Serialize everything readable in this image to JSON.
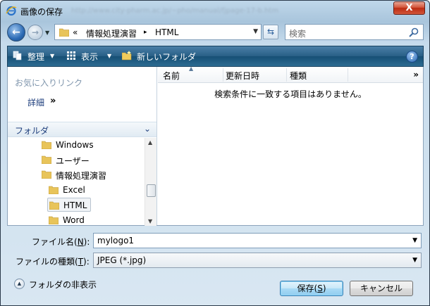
{
  "window": {
    "title": "画像の保存",
    "url_text": "http://www.city-pharm.ac.jp/~pho/manual/fjpage-17-b.htm",
    "close_label": "X"
  },
  "address_bar": {
    "prefix": "«",
    "crumbs": [
      "情報処理演習",
      "HTML"
    ],
    "separator": "▸"
  },
  "search": {
    "placeholder": "検索"
  },
  "toolbar": {
    "organize_label": "整理",
    "views_label": "表示",
    "new_folder_label": "新しいフォルダ",
    "help_label": "?"
  },
  "nav_pane": {
    "favorites_title": "お気に入りリンク",
    "detail_label": "詳細",
    "detail_chevron": "»",
    "folders_label": "フォルダ",
    "tree": [
      {
        "label": "Windows",
        "indent": 1
      },
      {
        "label": "ユーザー",
        "indent": 1
      },
      {
        "label": "情報処理演習",
        "indent": 1
      },
      {
        "label": "Excel",
        "indent": 2
      },
      {
        "label": "HTML",
        "indent": 2,
        "selected": true
      },
      {
        "label": "Word",
        "indent": 2
      }
    ]
  },
  "file_list": {
    "columns": [
      "名前",
      "更新日時",
      "種類"
    ],
    "more_label": "»",
    "empty_message": "検索条件に一致する項目はありません。"
  },
  "form": {
    "filename_label_pre": "ファイル名(",
    "filename_label_key": "N",
    "filename_label_post": "):",
    "filename_value": "mylogo1",
    "filetype_label_pre": "ファイルの種類(",
    "filetype_label_key": "T",
    "filetype_label_post": "):",
    "filetype_value": "JPEG (*.jpg)"
  },
  "footer": {
    "hide_folders_label": "フォルダの非表示",
    "save_label_pre": "保存(",
    "save_label_key": "S",
    "save_label_post": ")",
    "cancel_label": "キャンセル"
  },
  "colors": {
    "toolbar": "#285f86",
    "link_blue": "#1e3e7c",
    "close_red": "#c2331a",
    "default_button": "#a9daf5"
  }
}
